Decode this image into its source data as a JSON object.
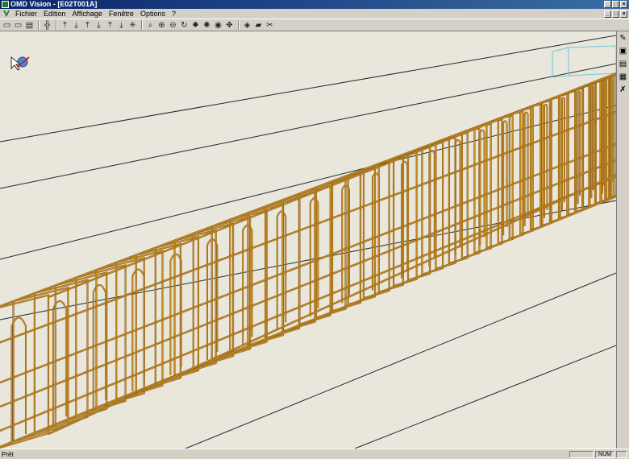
{
  "window": {
    "title": "OMD Vision - [E02T001A]",
    "min": "_",
    "max": "□",
    "close": "×"
  },
  "menu": {
    "items": [
      "Fichier",
      "Edition",
      "Affichage",
      "Fenêtre",
      "Options",
      "?"
    ]
  },
  "toolbar": {
    "icons": [
      "open-icon",
      "save-icon",
      "print-icon",
      "frame-icon",
      "axis-y-icon",
      "axis-x-icon",
      "axis-z-icon",
      "axis-yx-icon",
      "axis-xz-icon",
      "axis-zy-icon",
      "axis-all-icon",
      "zoom-window-icon",
      "zoom-in-icon",
      "zoom-out-icon",
      "rotate-icon",
      "star-icon",
      "sun-icon",
      "eye-icon",
      "pan-icon",
      "view-icon",
      "layers-icon",
      "tools-icon"
    ],
    "glyphs": [
      "▭",
      "▭",
      "▤",
      "╬",
      "⤒",
      "⤓",
      "⤒",
      "⤓",
      "⤒",
      "⤓",
      "✳",
      "⌕",
      "⊕",
      "⊖",
      "↻",
      "✹",
      "✺",
      "◉",
      "✥",
      "◈",
      "▰",
      "✂"
    ]
  },
  "sidebar": {
    "icons": [
      "info-icon",
      "copy-icon",
      "layers-icon",
      "grid-icon",
      "tools-icon"
    ],
    "glyphs": [
      "✎",
      "▣",
      "▤",
      "▦",
      "✗"
    ]
  },
  "status": {
    "text": "Prêt",
    "num": "NUM"
  },
  "colors": {
    "rebar": "#c8902a",
    "rebar_dark": "#8a5a10",
    "viewport_bg": "#e9e6dc",
    "line": "#1c2a2a"
  }
}
